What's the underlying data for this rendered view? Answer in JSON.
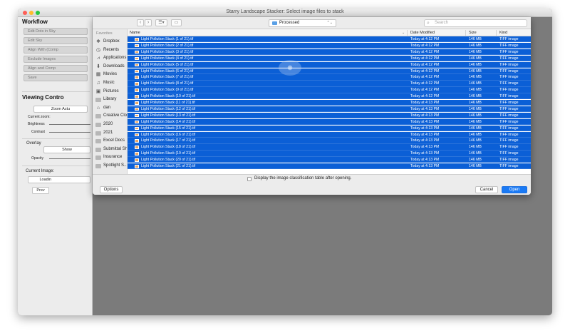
{
  "window": {
    "title": "Starry Landscape Stacker: Select image files to stack"
  },
  "left_panel": {
    "workflow_title": "Workflow",
    "workflow_buttons": [
      "Edit Dots in Sky",
      "Edit Sky",
      "Align With (Comp",
      "Exclude Images",
      "Align and Comp",
      "Save"
    ],
    "viewing_title": "Viewing Contro",
    "zoom_button": "Zoom Actu",
    "current_zoom_label": "Current zoom:",
    "brightness_label": "Brightness",
    "contrast_label": "Contrast",
    "overlay_label": "Overlay",
    "show_button": "Show",
    "opacity_label": "Opacity",
    "current_image_label": "Current Image:",
    "loading_text": "Loadin",
    "prev_button": "Prev"
  },
  "dialog": {
    "location": "Processed",
    "search_placeholder": "Search",
    "sidebar": {
      "heading": "Favorites",
      "items": [
        {
          "label": "Dropbox",
          "icon": "dropbox-icon"
        },
        {
          "label": "Recents",
          "icon": "clock-icon"
        },
        {
          "label": "Applications",
          "icon": "applications-icon"
        },
        {
          "label": "Downloads",
          "icon": "download-icon"
        },
        {
          "label": "Movies",
          "icon": "movies-icon"
        },
        {
          "label": "Music",
          "icon": "music-icon"
        },
        {
          "label": "Pictures",
          "icon": "camera-icon"
        },
        {
          "label": "Library",
          "icon": "folder-icon"
        },
        {
          "label": "dan",
          "icon": "home-icon"
        },
        {
          "label": "Creative Cloud...",
          "icon": "folder-icon"
        },
        {
          "label": "2020",
          "icon": "folder-icon"
        },
        {
          "label": "2021",
          "icon": "folder-icon"
        },
        {
          "label": "Excel Docs",
          "icon": "folder-icon"
        },
        {
          "label": "Submittal She...",
          "icon": "folder-icon"
        },
        {
          "label": "Insurance",
          "icon": "folder-icon"
        },
        {
          "label": "Spotlight S...",
          "icon": "folder-icon"
        }
      ]
    },
    "columns": {
      "name": "Name",
      "date": "Date Modified",
      "size": "Size",
      "kind": "Kind"
    },
    "files": [
      {
        "name": "Light Pollution Stack (1 of 21).tif",
        "date": "Today at 4:12 PM",
        "size": "146 MB",
        "kind": "TIFF image"
      },
      {
        "name": "Light Pollution Stack (2 of 21).tif",
        "date": "Today at 4:12 PM",
        "size": "146 MB",
        "kind": "TIFF image"
      },
      {
        "name": "Light Pollution Stack (3 of 21).tif",
        "date": "Today at 4:12 PM",
        "size": "146 MB",
        "kind": "TIFF image"
      },
      {
        "name": "Light Pollution Stack (4 of 21).tif",
        "date": "Today at 4:12 PM",
        "size": "146 MB",
        "kind": "TIFF image"
      },
      {
        "name": "Light Pollution Stack (5 of 21).tif",
        "date": "Today at 4:12 PM",
        "size": "146 MB",
        "kind": "TIFF image"
      },
      {
        "name": "Light Pollution Stack (6 of 21).tif",
        "date": "Today at 4:12 PM",
        "size": "146 MB",
        "kind": "TIFF image"
      },
      {
        "name": "Light Pollution Stack (7 of 21).tif",
        "date": "Today at 4:12 PM",
        "size": "146 MB",
        "kind": "TIFF image"
      },
      {
        "name": "Light Pollution Stack (8 of 21).tif",
        "date": "Today at 4:12 PM",
        "size": "146 MB",
        "kind": "TIFF image"
      },
      {
        "name": "Light Pollution Stack (9 of 21).tif",
        "date": "Today at 4:12 PM",
        "size": "146 MB",
        "kind": "TIFF image"
      },
      {
        "name": "Light Pollution Stack (10 of 21).tif",
        "date": "Today at 4:12 PM",
        "size": "146 MB",
        "kind": "TIFF image"
      },
      {
        "name": "Light Pollution Stack (11 of 21).tif",
        "date": "Today at 4:13 PM",
        "size": "146 MB",
        "kind": "TIFF image"
      },
      {
        "name": "Light Pollution Stack (12 of 21).tif",
        "date": "Today at 4:13 PM",
        "size": "146 MB",
        "kind": "TIFF image"
      },
      {
        "name": "Light Pollution Stack (13 of 21).tif",
        "date": "Today at 4:13 PM",
        "size": "146 MB",
        "kind": "TIFF image"
      },
      {
        "name": "Light Pollution Stack (14 of 21).tif",
        "date": "Today at 4:13 PM",
        "size": "146 MB",
        "kind": "TIFF image"
      },
      {
        "name": "Light Pollution Stack (15 of 21).tif",
        "date": "Today at 4:13 PM",
        "size": "146 MB",
        "kind": "TIFF image"
      },
      {
        "name": "Light Pollution Stack (16 of 21).tif",
        "date": "Today at 4:13 PM",
        "size": "146 MB",
        "kind": "TIFF image"
      },
      {
        "name": "Light Pollution Stack (17 of 21).tif",
        "date": "Today at 4:13 PM",
        "size": "146 MB",
        "kind": "TIFF image"
      },
      {
        "name": "Light Pollution Stack (18 of 21).tif",
        "date": "Today at 4:13 PM",
        "size": "146 MB",
        "kind": "TIFF image"
      },
      {
        "name": "Light Pollution Stack (19 of 21).tif",
        "date": "Today at 4:13 PM",
        "size": "146 MB",
        "kind": "TIFF image"
      },
      {
        "name": "Light Pollution Stack (20 of 21).tif",
        "date": "Today at 4:13 PM",
        "size": "146 MB",
        "kind": "TIFF image"
      },
      {
        "name": "Light Pollution Stack (21 of 21).tif",
        "date": "Today at 4:13 PM",
        "size": "146 MB",
        "kind": "TIFF image"
      }
    ],
    "checkbox_label": "Display the image classification table after opening.",
    "options_button": "Options",
    "cancel_button": "Cancel",
    "open_button": "Open"
  },
  "colors": {
    "selection": "#0b5fd6",
    "primary_button": "#1a7af5",
    "window_background": "#7b7b7b"
  }
}
